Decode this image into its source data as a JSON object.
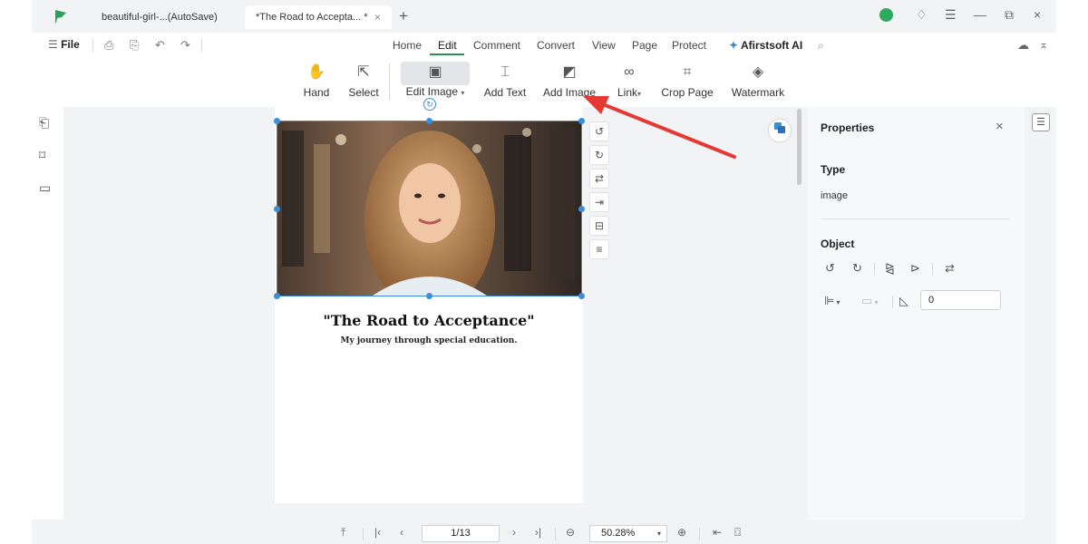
{
  "tabs": [
    {
      "label": "beautiful-girl-...(AutoSave)"
    },
    {
      "label": "*The Road to Accepta... *",
      "close": "×"
    }
  ],
  "new_tab": "+",
  "window": {
    "bell": "♢",
    "menu": "☰",
    "minimize": "—",
    "restore": "⧉",
    "close": "×"
  },
  "menubar": {
    "file_label": "File",
    "items": [
      "Home",
      "Edit",
      "Comment",
      "Convert",
      "View",
      "Page",
      "Protect"
    ],
    "ai_label": "Afirstsoft AI",
    "search_icon": "search-icon"
  },
  "ribbon": [
    {
      "label": "Hand",
      "icon": "hand-icon"
    },
    {
      "label": "Select",
      "icon": "cursor-icon"
    },
    {
      "label": "Edit Image",
      "icon": "image-frame-icon",
      "dropdown": true,
      "selected": true
    },
    {
      "label": "Add Text",
      "icon": "text-box-icon"
    },
    {
      "label": "Add Image",
      "icon": "add-image-icon"
    },
    {
      "label": "Link",
      "icon": "link-icon",
      "dropdown": true
    },
    {
      "label": "Crop Page",
      "icon": "crop-icon"
    },
    {
      "label": "Watermark",
      "icon": "watermark-icon"
    }
  ],
  "document": {
    "title": "\"The Road to Acceptance\"",
    "subtitle": "My journey through special education."
  },
  "properties": {
    "title": "Properties",
    "close": "×",
    "type_heading": "Type",
    "type_value": "image",
    "object_heading": "Object",
    "opacity_value": "0"
  },
  "status": {
    "page": "1/13",
    "zoom": "50.28%"
  },
  "colors": {
    "accent": "#2c8f55",
    "selection": "#3b8fd6",
    "annotation": "#e53935"
  }
}
